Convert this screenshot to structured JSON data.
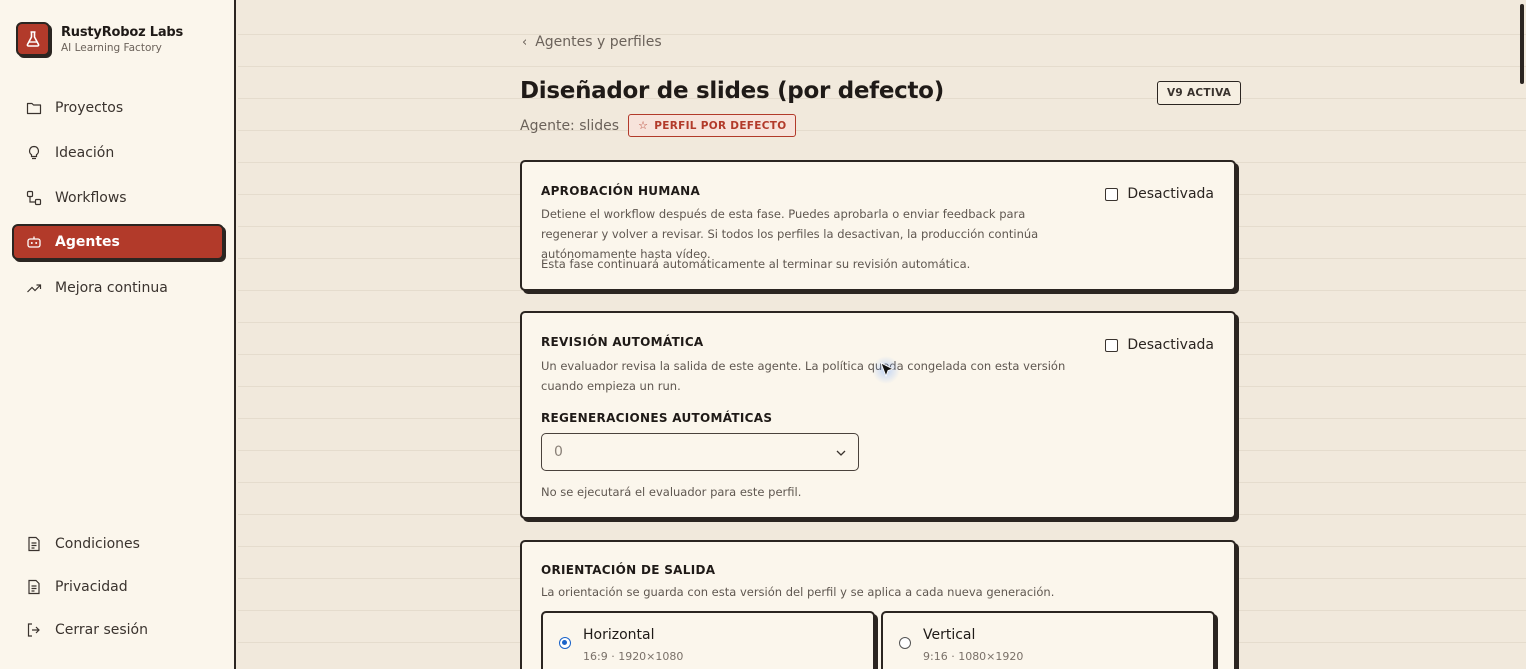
{
  "brand": {
    "name": "RustyRoboz Labs",
    "subtitle": "AI Learning Factory"
  },
  "sidebar": {
    "items": [
      {
        "label": "Proyectos",
        "icon": "folder-icon"
      },
      {
        "label": "Ideación",
        "icon": "lightbulb-icon"
      },
      {
        "label": "Workflows",
        "icon": "workflow-icon"
      },
      {
        "label": "Agentes",
        "icon": "bot-icon",
        "active": true
      },
      {
        "label": "Mejora continua",
        "icon": "trending-up-icon"
      }
    ],
    "footer": [
      {
        "label": "Condiciones",
        "icon": "document-icon"
      },
      {
        "label": "Privacidad",
        "icon": "document-icon"
      },
      {
        "label": "Cerrar sesión",
        "icon": "logout-icon"
      }
    ]
  },
  "header": {
    "back_label": "Agentes y perfiles",
    "title": "Diseñador de slides (por defecto)",
    "version_badge": "V9 ACTIVA",
    "agent_label": "Agente: slides",
    "default_badge": "PERFIL POR DEFECTO"
  },
  "approval": {
    "title": "APROBACIÓN HUMANA",
    "description": "Detiene el workflow después de esta fase. Puedes aprobarla o enviar feedback para regenerar y volver a revisar. Si todos los perfiles la desactivan, la producción continúa autónomamente hasta vídeo.",
    "note": "Esta fase continuará automáticamente al terminar su revisión automática.",
    "toggle_label": "Desactivada"
  },
  "auto_review": {
    "title": "REVISIÓN AUTOMÁTICA",
    "description": "Un evaluador revisa la salida de este agente. La política queda congelada con esta versión cuando empieza un run.",
    "toggle_label": "Desactivada",
    "regen_label": "REGENERACIONES AUTOMÁTICAS",
    "regen_value": "0",
    "note": "No se ejecutará el evaluador para este perfil."
  },
  "orientation": {
    "title": "ORIENTACIÓN DE SALIDA",
    "description": "La orientación se guarda con esta versión del perfil y se aplica a cada nueva generación.",
    "options": [
      {
        "label": "Horizontal",
        "sub": "16:9 · 1920×1080",
        "selected": true
      },
      {
        "label": "Vertical",
        "sub": "9:16 · 1080×1920",
        "selected": false
      }
    ]
  },
  "colors": {
    "accent": "#b23a2a",
    "ink": "#2b2521",
    "paper": "#fbf6ec",
    "background": "#f1e9dc",
    "radio": "#1a63c9"
  }
}
